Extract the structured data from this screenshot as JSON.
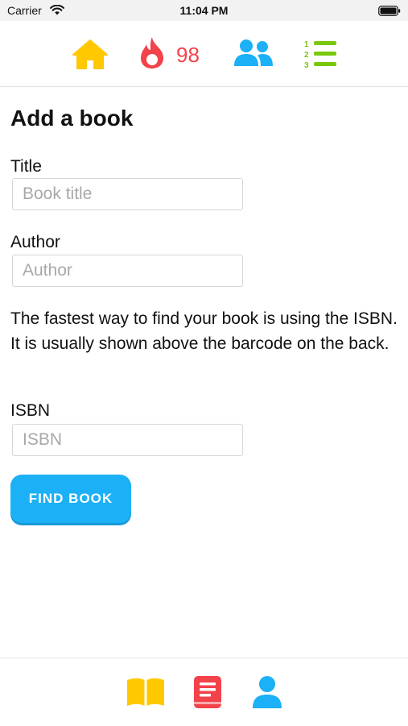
{
  "status_bar": {
    "carrier": "Carrier",
    "time": "11:04 PM",
    "wifi_icon": "wifi-icon",
    "battery_icon": "battery-icon"
  },
  "top_nav": {
    "home_icon": "home-icon",
    "streak_icon": "flame-icon",
    "streak_count": "98",
    "friends_icon": "people-icon",
    "lists_icon": "numbered-list-icon"
  },
  "form": {
    "title": "Add a book",
    "title_label": "Title",
    "title_placeholder": "Book title",
    "title_value": "",
    "author_label": "Author",
    "author_placeholder": "Author",
    "author_value": "",
    "help_text": "The fastest way to find your book is using the ISBN. It is usually shown above the barcode on the back.",
    "isbn_label": "ISBN",
    "isbn_placeholder": "ISBN",
    "isbn_value": "",
    "find_button_label": "FIND BOOK"
  },
  "bottom_nav": {
    "items": [
      {
        "icon": "open-book-icon"
      },
      {
        "icon": "book-icon"
      },
      {
        "icon": "profile-icon"
      }
    ]
  },
  "colors": {
    "home": "#ffc800",
    "streak": "#f2424a",
    "friends": "#1cb0f6",
    "lists": "#7ac70c",
    "primary_button": "#1cb0f6"
  }
}
